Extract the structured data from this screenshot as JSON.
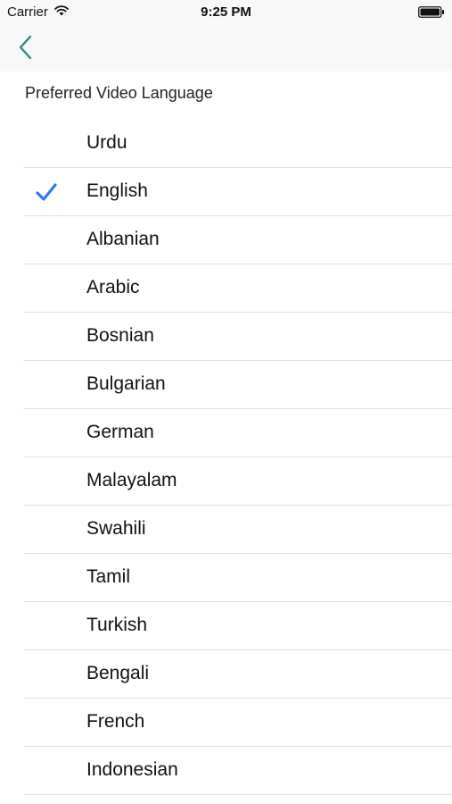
{
  "status_bar": {
    "carrier": "Carrier",
    "time": "9:25 PM",
    "icons": [
      "wifi-icon",
      "battery-icon"
    ]
  },
  "nav": {
    "back_icon": "chevron-left-icon",
    "accent_color": "#2b8a8a"
  },
  "section": {
    "title": "Preferred Video Language"
  },
  "languages": [
    {
      "label": "Urdu",
      "selected": false
    },
    {
      "label": "English",
      "selected": true
    },
    {
      "label": "Albanian",
      "selected": false
    },
    {
      "label": "Arabic",
      "selected": false
    },
    {
      "label": "Bosnian",
      "selected": false
    },
    {
      "label": "Bulgarian",
      "selected": false
    },
    {
      "label": "German",
      "selected": false
    },
    {
      "label": "Malayalam",
      "selected": false
    },
    {
      "label": "Swahili",
      "selected": false
    },
    {
      "label": "Tamil",
      "selected": false
    },
    {
      "label": "Turkish",
      "selected": false
    },
    {
      "label": "Bengali",
      "selected": false
    },
    {
      "label": "French",
      "selected": false
    },
    {
      "label": "Indonesian",
      "selected": false
    }
  ],
  "check_color": "#3478f6"
}
